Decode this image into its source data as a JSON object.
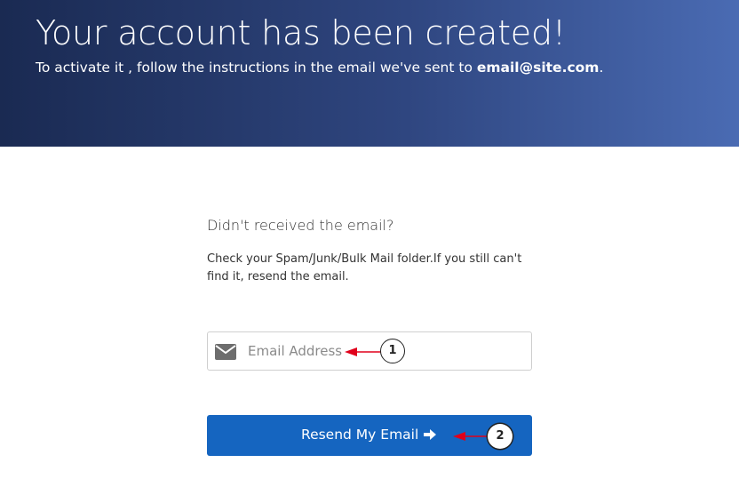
{
  "hero": {
    "title": "Your account has been created!",
    "subtitle_prefix": "To activate it , follow the instructions in the email we've sent to ",
    "email": "email@site.com",
    "subtitle_suffix": "."
  },
  "content": {
    "heading": "Didn't received the email?",
    "instructions": "Check your Spam/Junk/Bulk Mail folder.If you still can't find it, resend the email."
  },
  "form": {
    "email_placeholder": "Email Address",
    "email_value": "",
    "email_icon": "envelope-icon",
    "resend_label": "Resend My Email",
    "resend_icon": "arrow-right-icon"
  },
  "annotations": {
    "callout_1": "1",
    "callout_2": "2",
    "arrow_color": "#e0001b"
  },
  "colors": {
    "hero_gradient_start": "#1a2a52",
    "hero_gradient_end": "#4a6bb3",
    "button": "#1565c0"
  }
}
